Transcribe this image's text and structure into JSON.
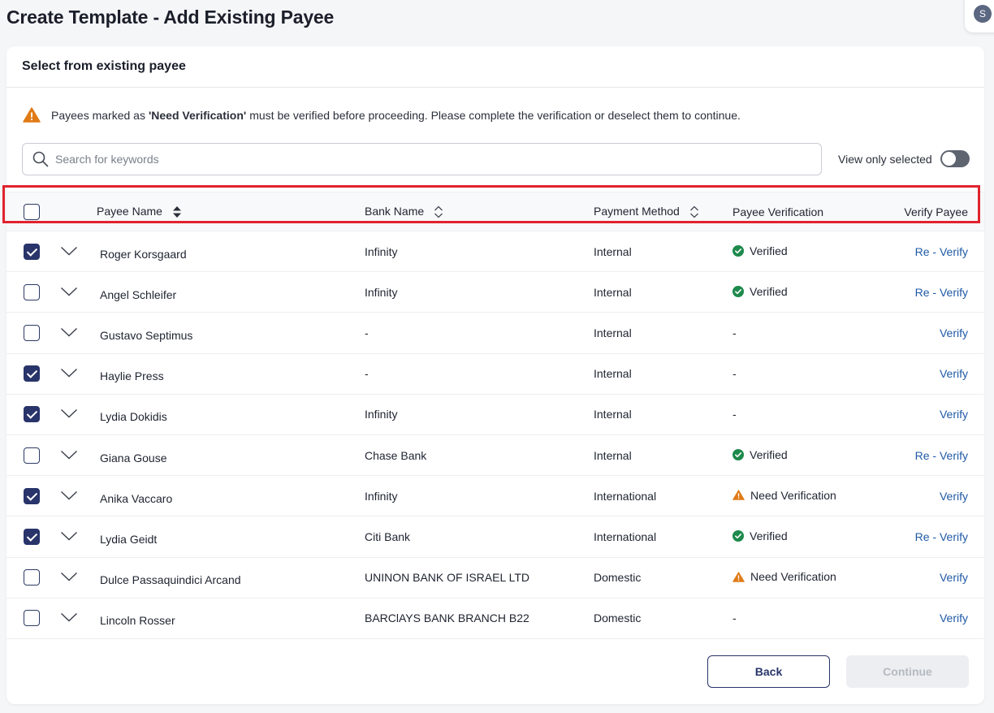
{
  "page": {
    "title": "Create Template - Add Existing Payee",
    "avatar_initial": "S"
  },
  "card": {
    "header": "Select from existing payee",
    "warning": {
      "prefix": "Payees marked as",
      "highlight": "'Need Verification'",
      "suffix": "must be verified before proceeding. Please complete the verification or deselect them to continue."
    },
    "search": {
      "placeholder": "Search for keywords",
      "value": ""
    },
    "toggle": {
      "label": "View only selected",
      "on": false
    }
  },
  "table": {
    "columns": {
      "name": "Payee Name",
      "bank": "Bank Name",
      "method": "Payment Method",
      "verification": "Payee Verification",
      "action": "Verify Payee"
    },
    "header_checked": false,
    "rows": [
      {
        "checked": true,
        "name": "Roger Korsgaard",
        "bank": "Infinity",
        "method": "Internal",
        "verification": "Verified",
        "action": "Re - Verify"
      },
      {
        "checked": false,
        "name": "Angel Schleifer",
        "bank": "Infinity",
        "method": "Internal",
        "verification": "Verified",
        "action": "Re - Verify"
      },
      {
        "checked": false,
        "name": "Gustavo Septimus",
        "bank": "-",
        "method": "Internal",
        "verification": "-",
        "action": "Verify"
      },
      {
        "checked": true,
        "name": "Haylie Press",
        "bank": "-",
        "method": "Internal",
        "verification": "-",
        "action": "Verify"
      },
      {
        "checked": true,
        "name": "Lydia Dokidis",
        "bank": "Infinity",
        "method": "Internal",
        "verification": "-",
        "action": "Verify"
      },
      {
        "checked": false,
        "name": "Giana Gouse",
        "bank": "Chase Bank",
        "method": "Internal",
        "verification": "Verified",
        "action": "Re - Verify"
      },
      {
        "checked": true,
        "name": "Anika Vaccaro",
        "bank": "Infinity",
        "method": "International",
        "verification": "Need Verification",
        "action": "Verify"
      },
      {
        "checked": true,
        "name": "Lydia Geidt",
        "bank": "Citi Bank",
        "method": "International",
        "verification": "Verified",
        "action": "Re - Verify"
      },
      {
        "checked": false,
        "name": "Dulce Passaquindici Arcand",
        "bank": "UNINON BANK OF ISRAEL LTD",
        "method": "Domestic",
        "verification": "Need Verification",
        "action": "Verify"
      },
      {
        "checked": false,
        "name": "Lincoln Rosser",
        "bank": "BARClAYS BANK BRANCH B22",
        "method": "Domestic",
        "verification": "-",
        "action": "Verify"
      }
    ]
  },
  "footer": {
    "back": "Back",
    "continue": "Continue"
  },
  "colors": {
    "primary": "#28346a",
    "link": "#1f5aa6",
    "verified": "#1e8a4c",
    "warning": "#e07b16",
    "highlight_border": "#e0232e"
  },
  "icons": {
    "warning": "warning-triangle-icon",
    "search": "search-icon",
    "verified": "check-circle-icon",
    "need_verification": "warning-triangle-icon",
    "expand": "chevron-down-icon",
    "sort": "sort-icon"
  }
}
